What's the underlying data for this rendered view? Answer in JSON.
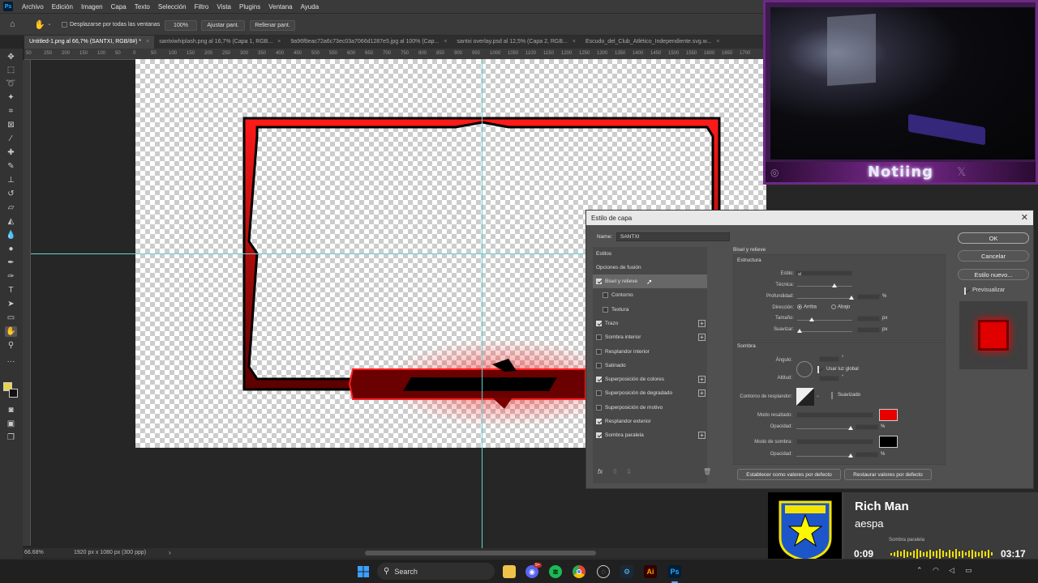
{
  "menubar": {
    "app_icon": "Ps",
    "items": [
      "Archivo",
      "Edición",
      "Imagen",
      "Capa",
      "Texto",
      "Selección",
      "Filtro",
      "Vista",
      "Plugins",
      "Ventana",
      "Ayuda"
    ]
  },
  "options": {
    "scroll_all_label": "Desplazarse por todas las ventanas",
    "zoom_value": "100%",
    "fit_screen": "Ajustar pant.",
    "fill_screen": "Rellenar pant."
  },
  "tabs": [
    {
      "label": "Untitled-1.png al 66,7% (SANTXI, RGB/8#) *",
      "active": true
    },
    {
      "label": "santxiwhiplash.png al 16,7% (Capa 1, RGB..."
    },
    {
      "label": "9a96f8eac72a6c73ec03a7066d1287e5.jpg al 100% (Cap..."
    },
    {
      "label": "santxi overlay.psd al 12,5% (Capa 2, RGB..."
    },
    {
      "label": "Escudo_del_Club_Atlético_Independiente.svg.w..."
    }
  ],
  "ruler_ticks": [
    "50",
    "250",
    "200",
    "150",
    "100",
    "50",
    "0",
    "50",
    "100",
    "150",
    "200",
    "250",
    "300",
    "350",
    "400",
    "450",
    "500",
    "550",
    "600",
    "650",
    "700",
    "750",
    "800",
    "850",
    "900",
    "950",
    "1000",
    "1050",
    "1100",
    "1150",
    "1200",
    "1250",
    "1300",
    "1350",
    "1400",
    "1450",
    "1500",
    "1550",
    "1600",
    "1650",
    "1700"
  ],
  "status": {
    "zoom": "66.68%",
    "doc_size": "1920 px x 1080 px (300 ppp)"
  },
  "webcam": {
    "streamer_name": "Notiing"
  },
  "dialog": {
    "title": "Estilo de capa",
    "name_label": "Name:",
    "name_value": "SANTXI",
    "styles_header": "Estilos",
    "blending_options": "Opciones de fusión",
    "styles": [
      {
        "label": "Bisel y relieve",
        "checked": true,
        "plus": false,
        "selected": true,
        "indent": false
      },
      {
        "label": "Contorno",
        "checked": false,
        "plus": false,
        "indent": true
      },
      {
        "label": "Textura",
        "checked": false,
        "plus": false,
        "indent": true
      },
      {
        "label": "Trazo",
        "checked": true,
        "plus": true,
        "indent": false
      },
      {
        "label": "Sombra interior",
        "checked": false,
        "plus": true,
        "indent": false
      },
      {
        "label": "Resplandor interior",
        "checked": false,
        "plus": false,
        "indent": false
      },
      {
        "label": "Satinado",
        "checked": false,
        "plus": false,
        "indent": false
      },
      {
        "label": "Superposición de colores",
        "checked": true,
        "plus": true,
        "indent": false
      },
      {
        "label": "Superposición de degradado",
        "checked": false,
        "plus": true,
        "indent": false
      },
      {
        "label": "Superposición de motivo",
        "checked": false,
        "plus": false,
        "indent": false
      },
      {
        "label": "Resplandor exterior",
        "checked": true,
        "plus": false,
        "indent": false
      },
      {
        "label": "Sombra paralela",
        "checked": true,
        "plus": true,
        "indent": false
      }
    ],
    "section_title": "Bisel y relieve",
    "structure_title": "Estructura",
    "fields": {
      "estilo": "Estilo:",
      "estilo_value": "al",
      "tecnica": "Técnica:",
      "profundidad": "Profundidad:",
      "direccion": "Dirección:",
      "arriba": "Arriba",
      "abajo": "Abajo",
      "tamano": "Tamaño:",
      "suavizar": "Suavizar:",
      "percent": "%",
      "px": "px"
    },
    "shadow_title": "Sombra",
    "shadow": {
      "angulo": "Ángulo:",
      "usar_luz_global": "Usar luz global",
      "altitud": "Altitud:",
      "contorno": "Contorno de resplandor:",
      "suavizado": "Suavizado",
      "modo_resaltado": "Modo resaltado:",
      "opacidad1": "Opacidad:",
      "modo_sombra": "Modo de sombra:",
      "opacidad2": "Opacidad:",
      "percent": "%",
      "degree": "°",
      "highlight_color": "#e60000",
      "shadow_color": "#000000"
    },
    "btn_set_default": "Establecer como valores por defecto",
    "btn_reset_default": "Restaurar valores por defecto",
    "ok": "OK",
    "cancel": "Cancelar",
    "new_style": "Estilo nuevo...",
    "preview": "Previsualizar",
    "preview_checked": true,
    "preview_color": "#e00000",
    "fx": "fx"
  },
  "music": {
    "title": "Rich Man",
    "artist": "aespa",
    "elapsed": "0:09",
    "total": "03:17",
    "progress": 0.05,
    "overlay_text": "Sombra paralela"
  },
  "taskbar": {
    "search_placeholder": "Search",
    "apps": [
      "windows-icon",
      "search-icon",
      "file-explorer-icon",
      "discord-icon",
      "spotify-icon",
      "chrome-icon",
      "github-desktop-icon",
      "steam-icon",
      "illustrator-icon",
      "photoshop-icon"
    ],
    "ai_label": "Ai",
    "ps_label": "Ps",
    "discord_badge": "9+"
  }
}
